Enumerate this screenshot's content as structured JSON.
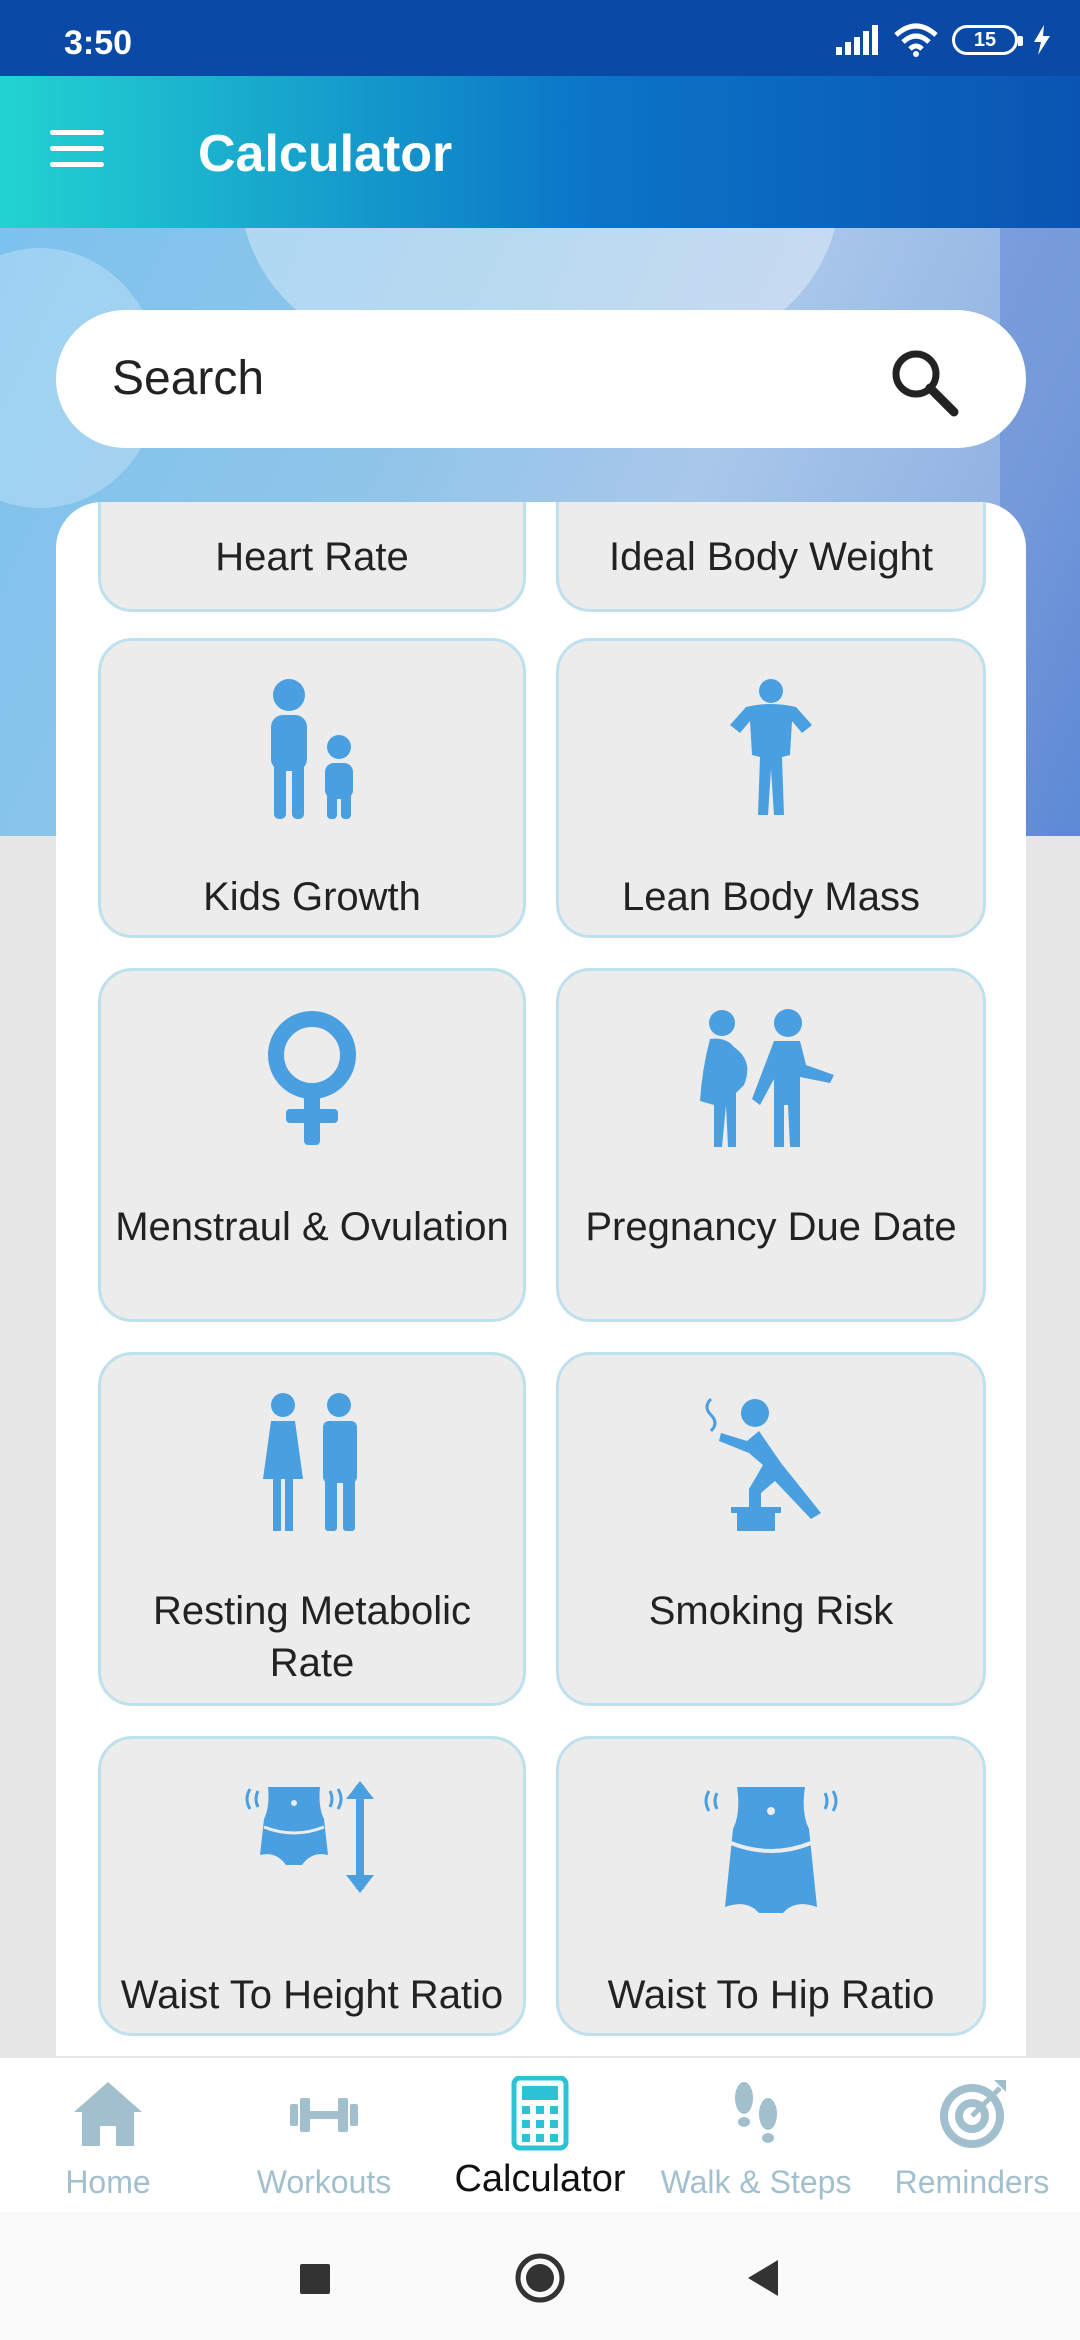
{
  "status_bar": {
    "time": "3:50",
    "battery": "15"
  },
  "app_bar": {
    "title": "Calculator"
  },
  "search": {
    "placeholder": "Search"
  },
  "tiles": [
    {
      "label": "Heart Rate",
      "icon": "heart-rate-icon"
    },
    {
      "label": "Ideal Body Weight",
      "icon": "ideal-body-weight-icon"
    },
    {
      "label": "Kids Growth",
      "icon": "parent-child-icon"
    },
    {
      "label": "Lean Body Mass",
      "icon": "muscular-body-icon"
    },
    {
      "label": "Menstraul & Ovulation",
      "icon": "female-symbol-icon"
    },
    {
      "label": "Pregnancy Due Date",
      "icon": "pregnant-couple-icon"
    },
    {
      "label": "Resting Metabolic Rate",
      "icon": "man-woman-icon"
    },
    {
      "label": "Smoking Risk",
      "icon": "smoking-person-icon"
    },
    {
      "label": "Waist To Height Ratio",
      "icon": "waist-height-icon"
    },
    {
      "label": "Waist To Hip Ratio",
      "icon": "waist-hip-icon"
    }
  ],
  "bottom_nav": [
    {
      "label": "Home",
      "icon": "home-icon"
    },
    {
      "label": "Workouts",
      "icon": "dumbbell-icon"
    },
    {
      "label": "Calculator",
      "icon": "calculator-icon",
      "active": true
    },
    {
      "label": "Walk & Steps",
      "icon": "footsteps-icon"
    },
    {
      "label": "Reminders",
      "icon": "target-icon"
    }
  ],
  "colors": {
    "accent": "#4a9fe0",
    "status_bar": "#0b49a6",
    "inactive_nav": "#a2bfce"
  }
}
